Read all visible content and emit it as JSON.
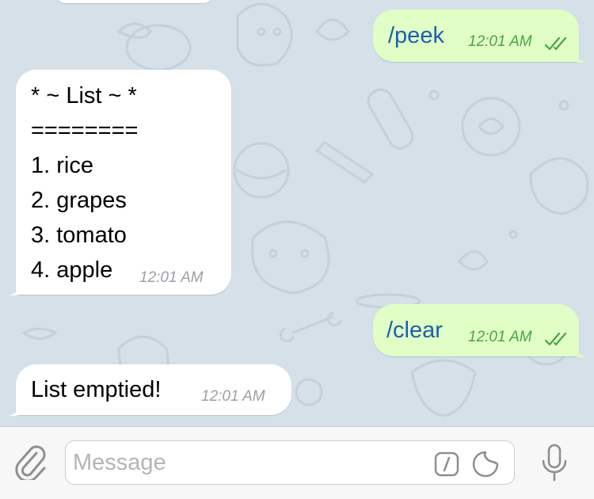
{
  "messages": [
    {
      "direction": "out",
      "text": "/peek",
      "time": "12:01 AM",
      "status": "read"
    },
    {
      "direction": "in",
      "lines": [
        "* ~ List ~ *",
        "========",
        "1. rice",
        "2. grapes",
        "3. tomato",
        "4. apple"
      ],
      "time": "12:01 AM"
    },
    {
      "direction": "out",
      "text": "/clear",
      "time": "12:01 AM",
      "status": "read"
    },
    {
      "direction": "in",
      "text": "List emptied!",
      "time": "12:01 AM"
    }
  ],
  "composer": {
    "placeholder": "Message",
    "icons": [
      "paperclip-icon",
      "bot-command-icon",
      "sticker-icon",
      "microphone-icon"
    ]
  },
  "colors": {
    "background": "#d6e0e8",
    "incoming_bubble": "#ffffff",
    "outgoing_bubble": "#e1fec6",
    "command_text": "#1b60ad",
    "outgoing_time": "#49a545",
    "incoming_time": "#9aa0a6"
  }
}
